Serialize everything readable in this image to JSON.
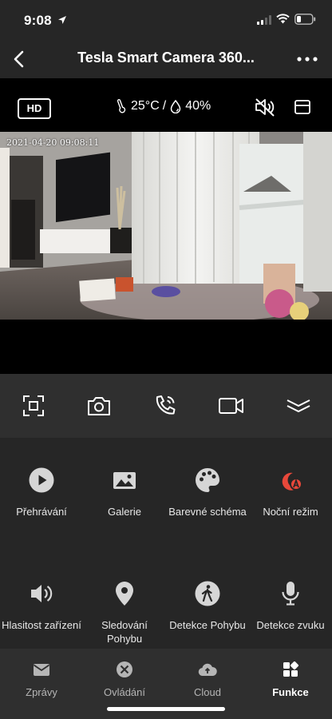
{
  "status": {
    "time": "9:08"
  },
  "nav": {
    "title": "Tesla Smart Camera 360..."
  },
  "camera": {
    "quality": "HD",
    "temperature": "25°C",
    "separator": "/",
    "humidity": "40%",
    "timestamp": "2021-04-20 09:08:11"
  },
  "features": [
    {
      "label": "Přehrávání",
      "icon": "play-icon"
    },
    {
      "label": "Galerie",
      "icon": "gallery-icon"
    },
    {
      "label": "Barevné schéma",
      "icon": "palette-icon"
    },
    {
      "label": "Noční režim",
      "icon": "night-mode-icon"
    },
    {
      "label": "Hlasitost zařízení",
      "icon": "volume-icon"
    },
    {
      "label": "Sledování Pohybu",
      "icon": "location-pin-icon"
    },
    {
      "label": "Detekce Pohybu",
      "icon": "walking-person-icon"
    },
    {
      "label": "Detekce zvuku",
      "icon": "microphone-icon"
    }
  ],
  "tabs": [
    {
      "label": "Zprávy",
      "icon": "message-icon"
    },
    {
      "label": "Ovládání",
      "icon": "control-icon"
    },
    {
      "label": "Cloud",
      "icon": "cloud-icon"
    },
    {
      "label": "Funkce",
      "icon": "functions-icon",
      "active": true
    }
  ],
  "colors": {
    "background": "#262626",
    "night_mode_accent": "#e8483a"
  }
}
